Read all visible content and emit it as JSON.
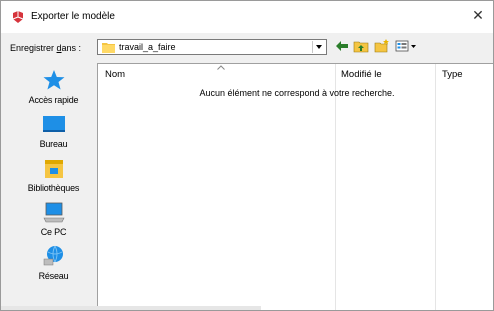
{
  "window": {
    "title": "Exporter le modèle",
    "close_glyph": "✕",
    "app_icon": "sketchup-icon"
  },
  "toolbar": {
    "save_in_label_prefix": "Enregistrer ",
    "save_in_label_underlined": "d",
    "save_in_label_suffix": "ans :",
    "folder_value": "travail_a_faire",
    "buttons": [
      "back-icon",
      "up-folder-icon",
      "new-folder-icon",
      "view-menu-icon"
    ]
  },
  "places": [
    {
      "label": "Accès rapide",
      "icon": "quick-access-star-icon"
    },
    {
      "label": "Bureau",
      "icon": "desktop-icon"
    },
    {
      "label": "Bibliothèques",
      "icon": "libraries-icon"
    },
    {
      "label": "Ce PC",
      "icon": "this-pc-icon"
    },
    {
      "label": "Réseau",
      "icon": "network-icon"
    }
  ],
  "filelist": {
    "columns": [
      "Nom",
      "Modifié le",
      "Type"
    ],
    "empty_message": "Aucun élément ne correspond à votre recherche."
  },
  "colors": {
    "accent_blue": "#1e8fe6",
    "folder_yellow": "#f5c542",
    "app_red": "#d6343c"
  }
}
